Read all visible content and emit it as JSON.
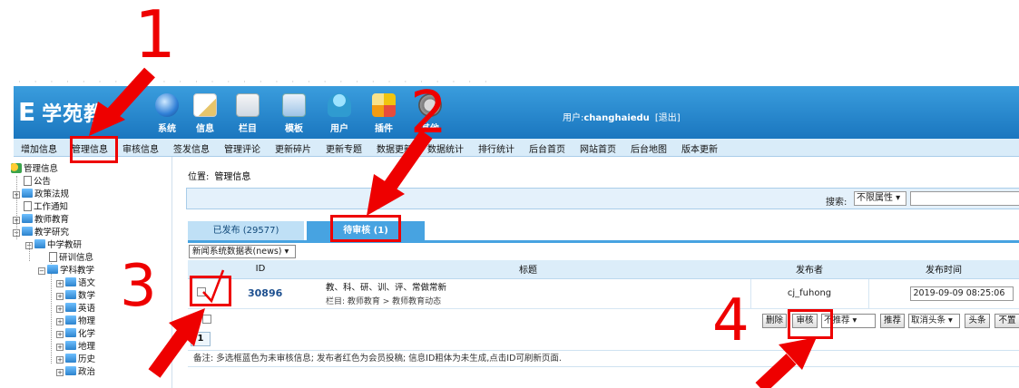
{
  "header": {
    "logo_text": "学苑教",
    "logo_letter": "E",
    "toolbar": [
      {
        "label": "系统",
        "icon": "globe-icon"
      },
      {
        "label": "信息",
        "icon": "document-pencil-icon"
      },
      {
        "label": "栏目",
        "icon": "folder-icon"
      },
      {
        "label": "模板",
        "icon": "window-icon"
      },
      {
        "label": "用户",
        "icon": "user-icon"
      },
      {
        "label": "插件",
        "icon": "tools-icon"
      },
      {
        "label": "其他",
        "icon": "gear-icon"
      }
    ],
    "user_label": "用户:",
    "username": "changhaiedu",
    "logout": "[退出]"
  },
  "submenu": [
    "增加信息",
    "管理信息",
    "审核信息",
    "签发信息",
    "管理评论",
    "更新碎片",
    "更新专题",
    "数据更新",
    "数据统计",
    "排行统计",
    "后台首页",
    "网站首页",
    "后台地图",
    "版本更新"
  ],
  "tree": {
    "root": "管理信息",
    "items": [
      "公告",
      "政策法规",
      "工作通知",
      "教师教育",
      "教学研究",
      "中学教研",
      "研训信息",
      "学科教学",
      "语文",
      "数学",
      "英语",
      "物理",
      "化学",
      "地理",
      "历史",
      "政治"
    ]
  },
  "breadcrumb": {
    "label": "位置:",
    "current": "管理信息"
  },
  "search": {
    "label": "搜索:",
    "attribute_select": "不限属性"
  },
  "tabs": {
    "published": "已发布 (29577)",
    "pending": "待审核 (1)"
  },
  "table_select": "新闻系统数据表(news)",
  "table": {
    "headers": {
      "id": "ID",
      "title": "标题",
      "publisher": "发布者",
      "time": "发布时间"
    },
    "rows": [
      {
        "id": "30896",
        "title": "教、科、研、训、评、常做常新",
        "column": "栏目: 教师教育 > 教师教育动态",
        "publisher": "cj_fuhong",
        "time": "2019-09-09 08:25:06"
      }
    ]
  },
  "actions": {
    "delete": "删除",
    "audit": "审核",
    "recommend_select": "不推荐",
    "recommend": "推荐",
    "cancel_headline_select": "取消头条",
    "headline": "头条",
    "cancel_top_partial": "不置"
  },
  "pagination": {
    "current": "1"
  },
  "note": "备注: 多选框蓝色为未审核信息; 发布者红色为会员投稿; 信息ID粗体为未生成,点击ID可刷新页面.",
  "annotations": {
    "step1": "1",
    "step2": "2",
    "step3": "3",
    "step4": "4",
    "annotation_color": "#ee0000"
  },
  "colors": {
    "header_blue": "#1a76bf",
    "tab_active": "#47a3e1",
    "submenu_bg": "#d9ecf9"
  }
}
